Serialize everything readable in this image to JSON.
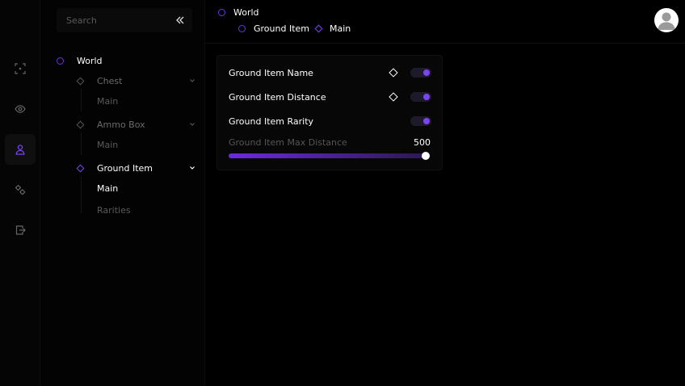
{
  "rail": {
    "items": [
      {
        "name": "crosshair-icon",
        "active": false
      },
      {
        "name": "eye-icon",
        "active": false
      },
      {
        "name": "user-icon",
        "active": true
      },
      {
        "name": "gears-icon",
        "active": false
      },
      {
        "name": "file-export-icon",
        "active": false
      }
    ]
  },
  "sidebar": {
    "search_placeholder": "Search",
    "root_label": "World",
    "groups": [
      {
        "label": "Chest",
        "children": [
          "Main"
        ]
      },
      {
        "label": "Ammo Box",
        "children": [
          "Main"
        ]
      },
      {
        "label": "Ground Item",
        "children": [
          "Main",
          "Rarities"
        ]
      }
    ]
  },
  "breadcrumb": {
    "root": "World",
    "parent": "Ground Item",
    "current": "Main"
  },
  "panel": {
    "options": [
      {
        "label": "Ground Item Name",
        "has_color": true,
        "enabled": true
      },
      {
        "label": "Ground Item Distance",
        "has_color": true,
        "enabled": true
      },
      {
        "label": "Ground Item Rarity",
        "has_color": false,
        "enabled": true
      }
    ],
    "slider": {
      "label": "Ground Item Max Distance",
      "value": "500",
      "fraction": 1.0
    }
  },
  "colors": {
    "accent": "#7a45f0",
    "background": "#000000"
  }
}
